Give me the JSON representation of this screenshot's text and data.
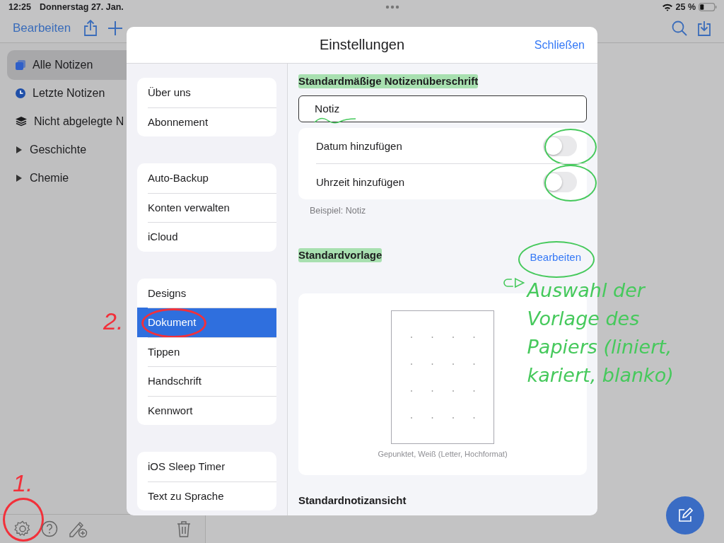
{
  "status_bar": {
    "time": "12:25",
    "date": "Donnerstag 27. Jan.",
    "battery": "25 %"
  },
  "nav": {
    "edit": "Bearbeiten"
  },
  "sidebar": {
    "items": [
      {
        "kind": "notes",
        "label": "Alle Notizen",
        "selected": true
      },
      {
        "kind": "recent",
        "label": "Letzte Notizen",
        "selected": false
      },
      {
        "kind": "unfiled",
        "label": "Nicht abgelegte N",
        "selected": false
      },
      {
        "kind": "folder",
        "label": "Geschichte",
        "selected": false
      },
      {
        "kind": "folder",
        "label": "Chemie",
        "selected": false
      }
    ]
  },
  "toolbar": [
    {
      "kind": "settings",
      "circled": true,
      "step_label": "1."
    },
    {
      "kind": "help",
      "circled": false
    },
    {
      "kind": "new-pencil",
      "circled": false
    },
    {
      "kind": "trash",
      "circled": false
    }
  ],
  "settings_dialog": {
    "title": "Einstellungen",
    "close": "Schließen",
    "menu_groups": [
      [
        {
          "label": "Über uns",
          "selected": false,
          "circled": false
        },
        {
          "label": "Abonnement",
          "selected": false,
          "circled": false
        }
      ],
      [
        {
          "label": "Auto-Backup",
          "selected": false,
          "circled": false
        },
        {
          "label": "Konten verwalten",
          "selected": false,
          "circled": false
        },
        {
          "label": "iCloud",
          "selected": false,
          "circled": false
        }
      ],
      [
        {
          "label": "Designs",
          "selected": false,
          "circled": false
        },
        {
          "label": "Dokument",
          "selected": true,
          "circled": true,
          "step_label": "2."
        },
        {
          "label": "Tippen",
          "selected": false,
          "circled": false
        },
        {
          "label": "Handschrift",
          "selected": false,
          "circled": false
        },
        {
          "label": "Kennwort",
          "selected": false,
          "circled": false
        }
      ],
      [
        {
          "label": "iOS Sleep Timer",
          "selected": false,
          "circled": false
        },
        {
          "label": "Text zu Sprache",
          "selected": false,
          "circled": false
        }
      ]
    ],
    "title_heading": {
      "text": "Standardmäßige Notizenüberschrift",
      "highlighted": true
    },
    "title_field": {
      "value": "Notiz",
      "underlined": true
    },
    "toggles": [
      {
        "label": "Datum hinzufügen",
        "on": false,
        "circled": true
      },
      {
        "label": "Uhrzeit hinzufügen",
        "on": false,
        "circled": true
      }
    ],
    "example": "Beispiel: Notiz",
    "template_section": {
      "heading": {
        "text": "Standardvorlage",
        "highlighted": true
      },
      "edit": {
        "label": "Bearbeiten",
        "circled": true
      },
      "note": "Auswahl der Vorlage des Papiers (liniert, kariert, blanko)",
      "caption": "Gepunktet, Weiß (Letter, Hochformat)"
    },
    "view_heading": "Standardnotizansicht"
  }
}
